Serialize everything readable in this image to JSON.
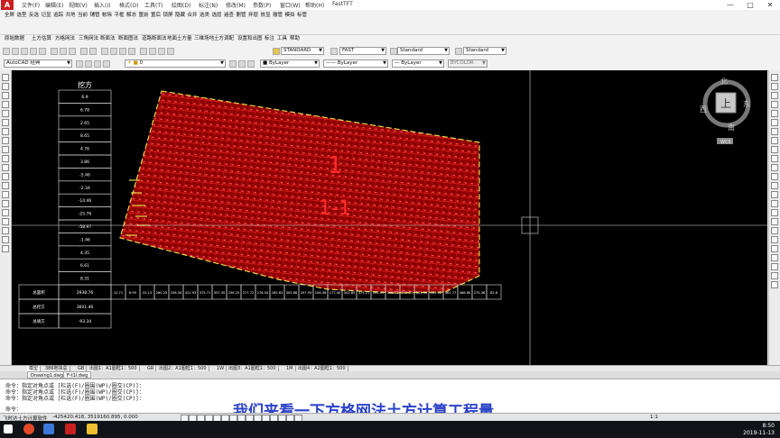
{
  "app": {
    "logo_letter": "A",
    "menus": [
      "文件(F)",
      "编辑(E)",
      "视图(V)",
      "插入(I)",
      "格式(O)",
      "工具(T)",
      "绘图(D)",
      "标注(N)",
      "修改(M)",
      "参数(P)",
      "窗口(W)",
      "帮助(H)",
      "FastTFT"
    ],
    "window_controls": [
      "—",
      "□",
      "✕"
    ]
  },
  "toolbar1": [
    "全屏",
    "选型",
    "反选",
    "记显",
    "追踪",
    "共地",
    "当前",
    "铺管",
    "帐除",
    "平框",
    "解冻",
    "置前",
    "置后",
    "锁屏",
    "隐藏",
    "合并",
    "选类",
    "选层",
    "遍查",
    "删管",
    "拌层",
    "放显",
    "撤管",
    "模拟",
    "标管"
  ],
  "toolbar2": [
    "原始数据",
    "土方估算",
    "方格网法",
    "三角网法",
    "断面法",
    "断面图法",
    "道路断面法",
    "地面土方量",
    "三维场地",
    "土方调配",
    "设置和出图",
    "标注",
    "工具",
    "帮助"
  ],
  "styles": {
    "text_style": "STANDARD",
    "dim_style": "FAST",
    "table_style": "Standard",
    "mleader_style": "Standard"
  },
  "layers_row": {
    "workspace": "AutoCAD 经典",
    "layer": "0",
    "color": "ByLayer",
    "linetype": "ByLayer",
    "lineweight": "ByLayer",
    "plotstyle": "BYCOLOR"
  },
  "table": {
    "header": "挖方",
    "rows": [
      "6.9",
      "6.78",
      "2.65",
      "8.65",
      "4.76",
      "3.86",
      "-5.46",
      "-2.34",
      "-14.46",
      "-25.76",
      "-58.97",
      "-1.46",
      "4.35",
      "6.61",
      "8.31"
    ],
    "footer": [
      {
        "label": "总面积",
        "value": "2938.76"
      },
      {
        "label": "总挖方",
        "value": "3601.46"
      },
      {
        "label": "总填方",
        "value": "-93.34"
      }
    ],
    "strip": [
      "12.71",
      "6.99",
      "22.13",
      "260.25",
      "256.54",
      "421.93",
      "375.71",
      "357.35",
      "258.25",
      "277.72",
      "176.54",
      "165.83",
      "305.86",
      "297.93",
      "156.36",
      "177.40",
      "341.85",
      "375.21",
      "295.03",
      "368.82",
      "342.21",
      "331.56",
      "404.00",
      "461.77",
      "468.80",
      "275.36",
      "82.8"
    ]
  },
  "drawing": {
    "label_top": "1",
    "label_bottom": "1-1",
    "cube": "上",
    "compass": {
      "n": "北",
      "s": "南",
      "e": "东",
      "w": "西"
    },
    "wcs": "WCS"
  },
  "layout_tabs": [
    "模型",
    "386地块总",
    "GB",
    "出图1：A1图框1：500",
    "GR",
    "出图2：A1图框1：500",
    "1W",
    "出图3：A1图框1：500",
    "1M",
    "出图4：A2图框1：500"
  ],
  "file_tabs": [
    "Drawing1.dwg",
    "F-t1l.dwg"
  ],
  "command_lines": [
    "命令：指定对角点或 [栏选(F)/圈围(WP)/圈交(CP)]：",
    "命令：指定对角点或 [栏选(F)/圈围(WP)/圈交(CP)]：",
    "命令：指定对角点或 [栏选(F)/圈围(WP)/圈交(CP)]：",
    "命令："
  ],
  "subtitle": "我们来看一下方格网法土方计算工程量",
  "status": {
    "software": "飞时达土方计算软件",
    "coords": "-425420.418, 3519160.895, 0.000",
    "zoom": "1:1",
    "time": "8:50",
    "date": "2019-11-13"
  }
}
